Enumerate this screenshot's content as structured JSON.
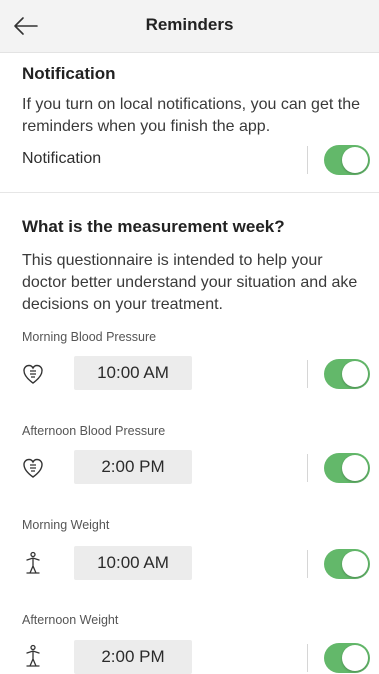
{
  "header": {
    "title": "Reminders"
  },
  "notification_section": {
    "title": "Notification",
    "description": "If you turn on local notifications, you can get the reminders when you finish the app.",
    "row_label": "Notification",
    "enabled": true
  },
  "measurement_section": {
    "title": "What is the measurement week?",
    "description": "This questionnaire is intended to help your doctor better understand your situation and ake decisions on your treatment."
  },
  "reminders": [
    {
      "label": "Morning Blood Pressure",
      "icon": "heart-icon",
      "time": "10:00 AM",
      "enabled": true
    },
    {
      "label": "Afternoon Blood Pressure",
      "icon": "heart-icon",
      "time": "2:00 PM",
      "enabled": true
    },
    {
      "label": "Morning Weight",
      "icon": "person-scale-icon",
      "time": "10:00 AM",
      "enabled": true
    },
    {
      "label": "Afternoon Weight",
      "icon": "person-scale-icon",
      "time": "2:00 PM",
      "enabled": true
    }
  ],
  "colors": {
    "toggle_on": "#63b86a",
    "header_bg": "#f3f3f3",
    "time_box_bg": "#ececec"
  }
}
